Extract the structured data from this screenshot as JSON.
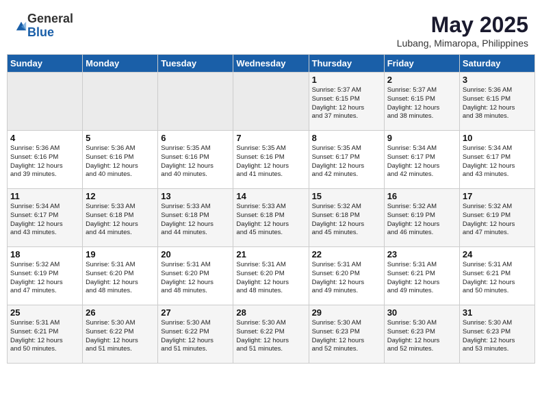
{
  "header": {
    "logo_general": "General",
    "logo_blue": "Blue",
    "title": "May 2025",
    "subtitle": "Lubang, Mimaropa, Philippines"
  },
  "weekdays": [
    "Sunday",
    "Monday",
    "Tuesday",
    "Wednesday",
    "Thursday",
    "Friday",
    "Saturday"
  ],
  "weeks": [
    [
      {
        "day": "",
        "text": ""
      },
      {
        "day": "",
        "text": ""
      },
      {
        "day": "",
        "text": ""
      },
      {
        "day": "",
        "text": ""
      },
      {
        "day": "1",
        "text": "Sunrise: 5:37 AM\nSunset: 6:15 PM\nDaylight: 12 hours\nand 37 minutes."
      },
      {
        "day": "2",
        "text": "Sunrise: 5:37 AM\nSunset: 6:15 PM\nDaylight: 12 hours\nand 38 minutes."
      },
      {
        "day": "3",
        "text": "Sunrise: 5:36 AM\nSunset: 6:15 PM\nDaylight: 12 hours\nand 38 minutes."
      }
    ],
    [
      {
        "day": "4",
        "text": "Sunrise: 5:36 AM\nSunset: 6:16 PM\nDaylight: 12 hours\nand 39 minutes."
      },
      {
        "day": "5",
        "text": "Sunrise: 5:36 AM\nSunset: 6:16 PM\nDaylight: 12 hours\nand 40 minutes."
      },
      {
        "day": "6",
        "text": "Sunrise: 5:35 AM\nSunset: 6:16 PM\nDaylight: 12 hours\nand 40 minutes."
      },
      {
        "day": "7",
        "text": "Sunrise: 5:35 AM\nSunset: 6:16 PM\nDaylight: 12 hours\nand 41 minutes."
      },
      {
        "day": "8",
        "text": "Sunrise: 5:35 AM\nSunset: 6:17 PM\nDaylight: 12 hours\nand 42 minutes."
      },
      {
        "day": "9",
        "text": "Sunrise: 5:34 AM\nSunset: 6:17 PM\nDaylight: 12 hours\nand 42 minutes."
      },
      {
        "day": "10",
        "text": "Sunrise: 5:34 AM\nSunset: 6:17 PM\nDaylight: 12 hours\nand 43 minutes."
      }
    ],
    [
      {
        "day": "11",
        "text": "Sunrise: 5:34 AM\nSunset: 6:17 PM\nDaylight: 12 hours\nand 43 minutes."
      },
      {
        "day": "12",
        "text": "Sunrise: 5:33 AM\nSunset: 6:18 PM\nDaylight: 12 hours\nand 44 minutes."
      },
      {
        "day": "13",
        "text": "Sunrise: 5:33 AM\nSunset: 6:18 PM\nDaylight: 12 hours\nand 44 minutes."
      },
      {
        "day": "14",
        "text": "Sunrise: 5:33 AM\nSunset: 6:18 PM\nDaylight: 12 hours\nand 45 minutes."
      },
      {
        "day": "15",
        "text": "Sunrise: 5:32 AM\nSunset: 6:18 PM\nDaylight: 12 hours\nand 45 minutes."
      },
      {
        "day": "16",
        "text": "Sunrise: 5:32 AM\nSunset: 6:19 PM\nDaylight: 12 hours\nand 46 minutes."
      },
      {
        "day": "17",
        "text": "Sunrise: 5:32 AM\nSunset: 6:19 PM\nDaylight: 12 hours\nand 47 minutes."
      }
    ],
    [
      {
        "day": "18",
        "text": "Sunrise: 5:32 AM\nSunset: 6:19 PM\nDaylight: 12 hours\nand 47 minutes."
      },
      {
        "day": "19",
        "text": "Sunrise: 5:31 AM\nSunset: 6:20 PM\nDaylight: 12 hours\nand 48 minutes."
      },
      {
        "day": "20",
        "text": "Sunrise: 5:31 AM\nSunset: 6:20 PM\nDaylight: 12 hours\nand 48 minutes."
      },
      {
        "day": "21",
        "text": "Sunrise: 5:31 AM\nSunset: 6:20 PM\nDaylight: 12 hours\nand 48 minutes."
      },
      {
        "day": "22",
        "text": "Sunrise: 5:31 AM\nSunset: 6:20 PM\nDaylight: 12 hours\nand 49 minutes."
      },
      {
        "day": "23",
        "text": "Sunrise: 5:31 AM\nSunset: 6:21 PM\nDaylight: 12 hours\nand 49 minutes."
      },
      {
        "day": "24",
        "text": "Sunrise: 5:31 AM\nSunset: 6:21 PM\nDaylight: 12 hours\nand 50 minutes."
      }
    ],
    [
      {
        "day": "25",
        "text": "Sunrise: 5:31 AM\nSunset: 6:21 PM\nDaylight: 12 hours\nand 50 minutes."
      },
      {
        "day": "26",
        "text": "Sunrise: 5:30 AM\nSunset: 6:22 PM\nDaylight: 12 hours\nand 51 minutes."
      },
      {
        "day": "27",
        "text": "Sunrise: 5:30 AM\nSunset: 6:22 PM\nDaylight: 12 hours\nand 51 minutes."
      },
      {
        "day": "28",
        "text": "Sunrise: 5:30 AM\nSunset: 6:22 PM\nDaylight: 12 hours\nand 51 minutes."
      },
      {
        "day": "29",
        "text": "Sunrise: 5:30 AM\nSunset: 6:23 PM\nDaylight: 12 hours\nand 52 minutes."
      },
      {
        "day": "30",
        "text": "Sunrise: 5:30 AM\nSunset: 6:23 PM\nDaylight: 12 hours\nand 52 minutes."
      },
      {
        "day": "31",
        "text": "Sunrise: 5:30 AM\nSunset: 6:23 PM\nDaylight: 12 hours\nand 53 minutes."
      }
    ]
  ]
}
